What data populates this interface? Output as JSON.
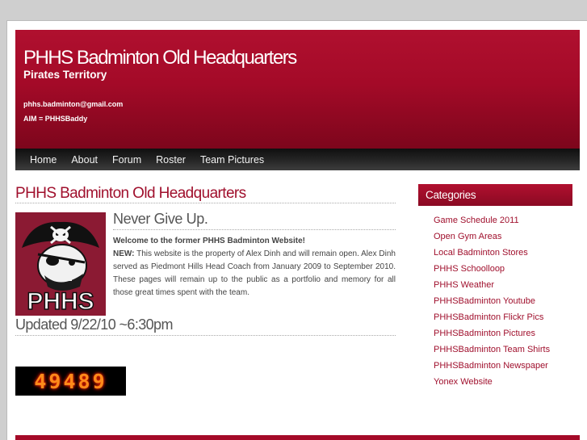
{
  "header": {
    "title": "PHHS Badminton Old Headquarters",
    "tagline": "Pirates Territory",
    "email": "phhs.badminton@gmail.com",
    "aim": "AIM = PHHSBaddy"
  },
  "nav": [
    {
      "label": "Home"
    },
    {
      "label": "About"
    },
    {
      "label": "Forum"
    },
    {
      "label": "Roster"
    },
    {
      "label": "Team Pictures"
    }
  ],
  "post": {
    "title": "PHHS Badminton Old Headquarters",
    "logo_text": "PHHS",
    "subheading": "Never Give Up.",
    "welcome": "Welcome to the former PHHS Badminton Website!",
    "new_label": "NEW:",
    "paragraph": " This website is the property of Alex Dinh and will remain open. Alex Dinh served as Piedmont Hills Head Coach from January 2009 to September 2010. These pages will remain up to the public as a portfolio and memory for all those great times spent with the team.",
    "updated": "Updated 9/22/10 ~6:30pm",
    "counter": "49489"
  },
  "sidebar": {
    "heading": "Categories",
    "items": [
      {
        "label": "Game Schedule 2011"
      },
      {
        "label": "Open Gym Areas"
      },
      {
        "label": "Local Badminton Stores"
      },
      {
        "label": "PHHS Schoolloop"
      },
      {
        "label": "PHHS Weather"
      },
      {
        "label": "PHHSBadminton Youtube"
      },
      {
        "label": "PHHSBadminton Flickr Pics"
      },
      {
        "label": "PHHSBadminton Pictures"
      },
      {
        "label": "PHHSBadminton Team Shirts"
      },
      {
        "label": "PHHSBadminton Newspaper"
      },
      {
        "label": "Yonex Website"
      }
    ]
  },
  "colors": {
    "brand_red": "#a40a28",
    "nav_dark": "#1a1a1a",
    "link_red": "#a0102d"
  }
}
